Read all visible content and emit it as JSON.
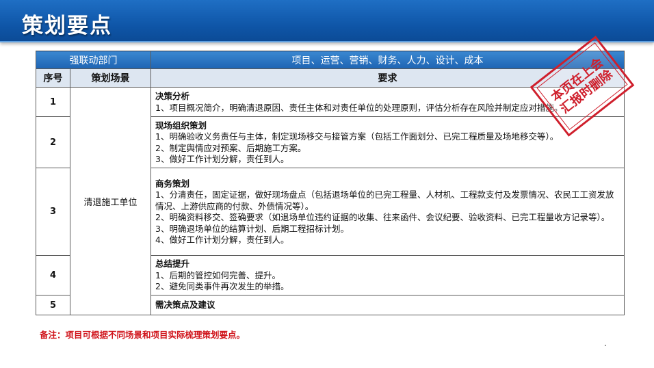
{
  "header": {
    "title": "策划要点"
  },
  "table": {
    "dept_label": "强联动部门",
    "dept_value": "项目、运营、营销、财务、人力、设计、成本",
    "col_seq": "序号",
    "col_scene": "策划场景",
    "col_req": "要求",
    "scene": "清退施工单位",
    "rows": [
      {
        "seq": "1",
        "title": "决策分析",
        "lines": [
          "1、项目概况简介，明确清退原因、责任主体和对责任单位的处理原则，评估分析存在风险并制定应对措施。"
        ]
      },
      {
        "seq": "2",
        "title": "现场组织策划",
        "lines": [
          "1、明确验收义务责任与主体，制定现场移交与接管方案（包括工作面划分、已完工程质量及场地移交等）。",
          "2、制定舆情应对预案、后期施工方案。",
          "3、做好工作计划分解，责任到人。"
        ]
      },
      {
        "seq": "3",
        "title": "商务策划",
        "lines": [
          "1、分清责任，固定证据，做好现场盘点（包括退场单位的已完工程量、人材机、工程款支付及发票情况、农民工工资发放情况、上游供应商的付款、外债情况等）。",
          "2、明确资料移交、签确要求（如退场单位违约证据的收集、往来函件、会议纪要、验收资料、已完工程量收方记录等）。",
          "3、明确退场单位的结算计划、后期工程招标计划。",
          "4、做好工作计划分解，责任到人。"
        ]
      },
      {
        "seq": "4",
        "title": "总结提升",
        "lines": [
          "1、后期的管控如何完善、提升。",
          "2、避免同类事件再次发生的举措。"
        ]
      },
      {
        "seq": "5",
        "title": "需决策点及建议",
        "lines": []
      }
    ]
  },
  "note": "备注：项目可根据不同场景和项目实际梳理策划要点。",
  "stamp": {
    "line1": "本页在上会",
    "line2": "汇报时删除"
  },
  "colors": {
    "header_blue": "#0f56a8",
    "stamp_red": "#cf1f2c",
    "note_red": "#d0141b"
  }
}
